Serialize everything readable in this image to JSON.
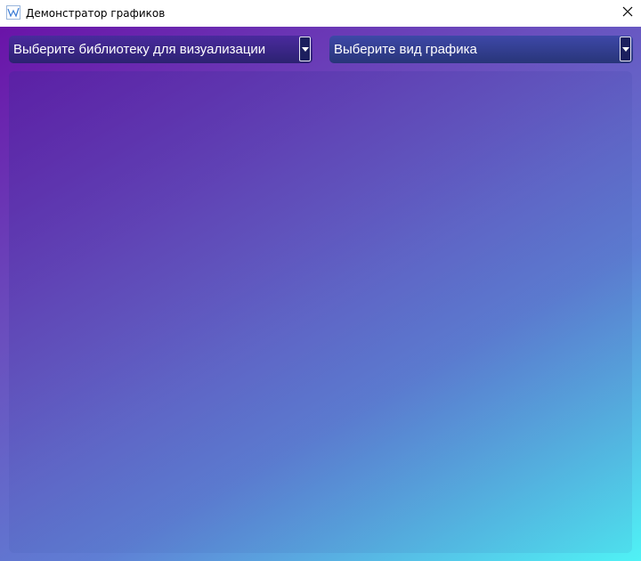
{
  "window": {
    "title": "Демонстратор графиков",
    "app_icon": "line-chart-icon",
    "close_icon": "close-icon"
  },
  "controls": {
    "library_select": {
      "selected": "Выберите библиотеку для визуализации",
      "arrow_icon": "chevron-down-icon"
    },
    "chart_type_select": {
      "selected": "Выберите вид графика",
      "arrow_icon": "chevron-down-icon"
    }
  },
  "colors": {
    "gradient_top_left": "#6a13a8",
    "gradient_bottom_right": "#4ff2f5",
    "combo_bg": "#2d2378",
    "text": "#ffffff"
  }
}
